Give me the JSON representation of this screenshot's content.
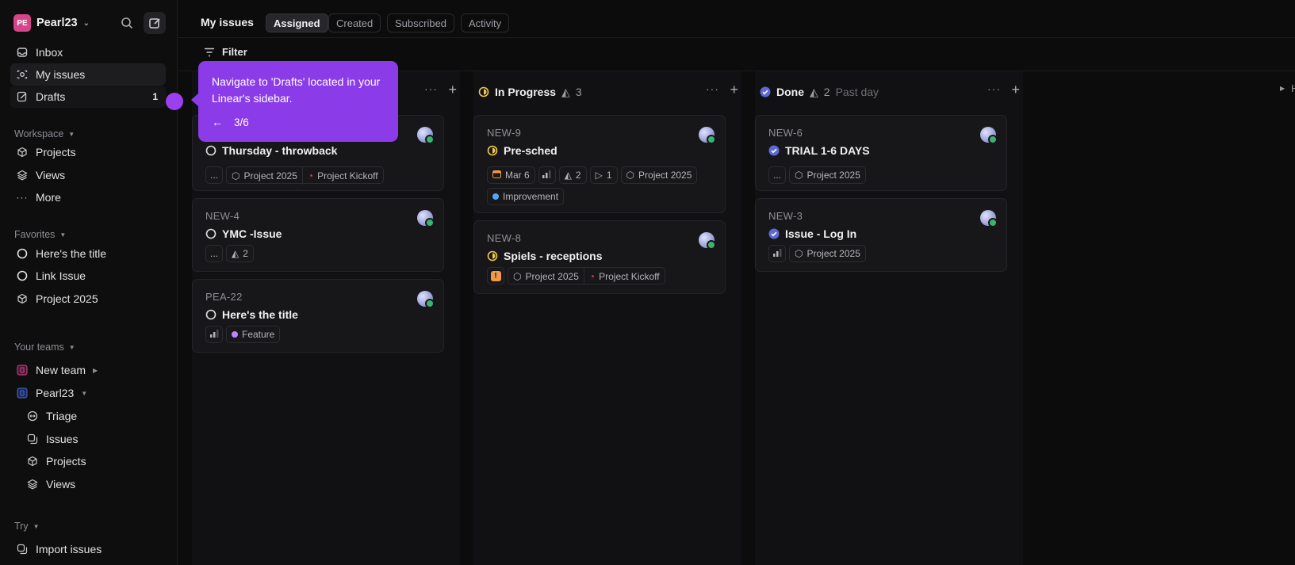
{
  "workspace": {
    "initials": "PE",
    "name": "Pearl23",
    "accent": "#d6458a"
  },
  "sidebar": {
    "items": [
      {
        "label": "Inbox",
        "icon": "inbox-icon"
      },
      {
        "label": "My issues",
        "icon": "my-issues-icon"
      },
      {
        "label": "Drafts",
        "icon": "drafts-icon",
        "count": "1"
      }
    ],
    "workspace_section": {
      "title": "Workspace",
      "items": [
        {
          "label": "Projects",
          "icon": "cube-icon"
        },
        {
          "label": "Views",
          "icon": "layers-icon"
        },
        {
          "label": "More",
          "icon": "ellipsis-icon"
        }
      ]
    },
    "favorites_section": {
      "title": "Favorites",
      "items": [
        {
          "label": "Here's the title",
          "icon": "circle-icon"
        },
        {
          "label": "Link Issue",
          "icon": "circle-icon"
        },
        {
          "label": "Project 2025",
          "icon": "cube-icon"
        }
      ]
    },
    "teams_section": {
      "title": "Your teams",
      "teams": [
        {
          "label": "New team",
          "color": "#d6458a"
        },
        {
          "label": "Pearl23",
          "color": "#4a6bd6"
        }
      ],
      "sub_items": [
        {
          "label": "Triage",
          "icon": "triage-icon"
        },
        {
          "label": "Issues",
          "icon": "issues-icon"
        },
        {
          "label": "Projects",
          "icon": "cube-icon"
        },
        {
          "label": "Views",
          "icon": "layers-icon"
        }
      ]
    },
    "try_section": {
      "title": "Try",
      "items": [
        {
          "label": "Import issues",
          "icon": "import-icon"
        }
      ]
    }
  },
  "header": {
    "title": "My issues",
    "tabs": [
      "Assigned",
      "Created",
      "Subscribed",
      "Activity"
    ],
    "selected_tab": "Assigned"
  },
  "filter": {
    "label": "Filter"
  },
  "columns": [
    {
      "title": "",
      "count": "",
      "cards": [
        {
          "id": "",
          "title": "Thursday - throwback",
          "chips": [
            "...",
            "Project 2025",
            "Project Kickoff"
          ]
        },
        {
          "id": "NEW-4",
          "title": "YMC -Issue",
          "chips": [
            "...",
            "2"
          ]
        },
        {
          "id": "PEA-22",
          "title": "Here's the title",
          "chips": [
            "Feature"
          ]
        }
      ]
    },
    {
      "title": "In Progress",
      "count": "3",
      "cards": [
        {
          "id": "NEW-9",
          "title": "Pre-sched",
          "chips": [
            "Mar 6",
            "2",
            "1",
            "Project 2025",
            "Improvement"
          ]
        },
        {
          "id": "NEW-8",
          "title": "Spiels - receptions",
          "chips": [
            "Project 2025",
            "Project Kickoff"
          ]
        }
      ]
    },
    {
      "title": "Done",
      "count": "2",
      "extra": "Past day",
      "cards": [
        {
          "id": "NEW-6",
          "title": "TRIAL 1-6 DAYS",
          "chips": [
            "...",
            "Project 2025"
          ]
        },
        {
          "id": "NEW-3",
          "title": "Issue - Log In",
          "chips": [
            "Project 2025"
          ]
        }
      ]
    }
  ],
  "hidden_columns_label": "H",
  "tooltip": {
    "text": "Navigate to 'Drafts' located in your Linear's sidebar.",
    "back": "←",
    "step": "3/6"
  },
  "colors": {
    "in_progress": "#f2c94c",
    "done": "#5e6ad2",
    "improvement": "#4ea7fc",
    "feature": "#bb87fc",
    "urgent": "#f2994a",
    "tooltip": "#8b3ce8"
  }
}
